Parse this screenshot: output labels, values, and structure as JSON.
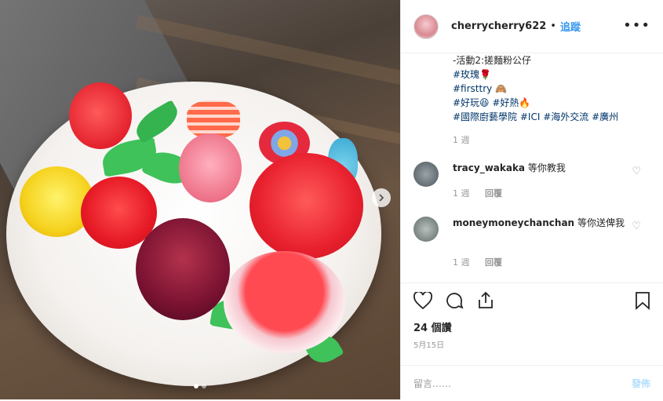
{
  "header": {
    "username": "cherrycherry622",
    "separator": "•",
    "follow_label": "追蹤",
    "more_icon": "more-dots-icon"
  },
  "caption": {
    "lines": [
      "-活動2:搓麵粉公仔",
      "#玫瑰🌹",
      "#firsttry 🙈",
      "#好玩😆 #好熱🔥",
      "#國際廚藝學院 #ICI #海外交流 #廣州"
    ],
    "time": "1 週"
  },
  "comments": [
    {
      "user": "tracy_wakaka",
      "text": "等你教我",
      "time": "1 週",
      "reply": "回覆"
    },
    {
      "user": "moneymoneychanchan",
      "text": "等你送俾我",
      "time": "1 週",
      "reply": "回覆"
    }
  ],
  "actions": {
    "likes": "24 個讚",
    "date": "5月15日",
    "comment_placeholder": "留言……",
    "post_label": "發佈",
    "icons": [
      "heart-icon",
      "comment-icon",
      "share-icon",
      "bookmark-icon"
    ]
  },
  "media": {
    "alt": "",
    "slides": 2,
    "active_slide": 1,
    "nav_next_icon": "chevron-right-icon"
  }
}
